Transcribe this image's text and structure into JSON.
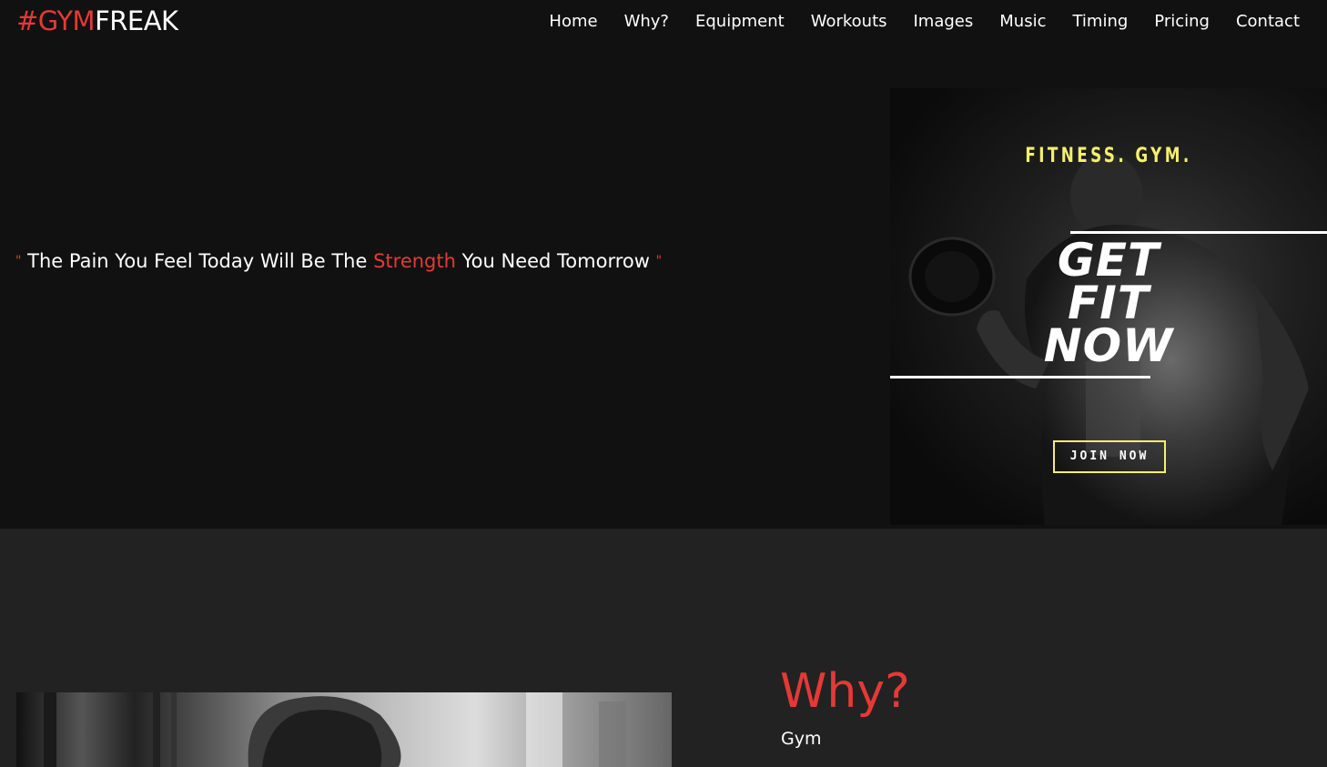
{
  "brand": {
    "prefix": "#GYM",
    "suffix": "FREAK"
  },
  "nav": {
    "items": [
      {
        "label": "Home"
      },
      {
        "label": "Why?"
      },
      {
        "label": "Equipment"
      },
      {
        "label": "Workouts"
      },
      {
        "label": "Images"
      },
      {
        "label": "Music"
      },
      {
        "label": "Timing"
      },
      {
        "label": "Pricing"
      },
      {
        "label": "Contact"
      }
    ]
  },
  "hero": {
    "quote_open": "\"",
    "quote_before": "The Pain You Feel Today Will Be The",
    "quote_highlight": "Strength",
    "quote_after": "You Need Tomorrow",
    "quote_close": "\"",
    "poster": {
      "tagline": "FITNESS. GYM.",
      "headline": [
        "GET",
        "FIT",
        "NOW"
      ],
      "cta": "JOIN NOW"
    }
  },
  "why": {
    "title": "Why?",
    "subtitle": "Gym"
  },
  "colors": {
    "accent": "#e53935",
    "poster_accent": "#f4ef6e",
    "bg_dark": "#111111",
    "bg_section": "#222222"
  }
}
